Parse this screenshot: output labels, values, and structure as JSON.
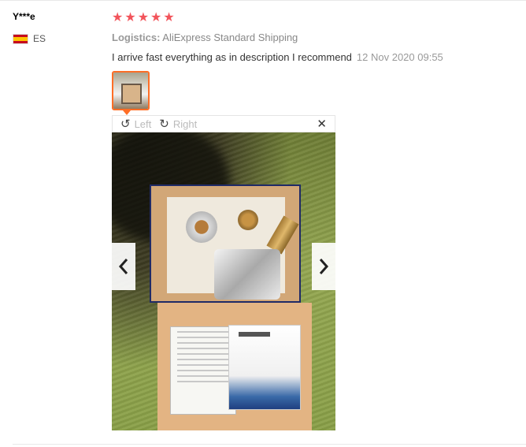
{
  "review": {
    "user_name": "Y***e",
    "country_code": "ES",
    "rating": 5,
    "stars": [
      "★",
      "★",
      "★",
      "★",
      "★"
    ],
    "logistics_label": "Logistics:",
    "logistics_value": " AliExpress Standard Shipping",
    "text": "I arrive fast everything as in description I recommend",
    "date": "12 Nov 2020 09:55"
  },
  "viewer": {
    "rotate_left_label": "Left",
    "rotate_right_label": "Right",
    "rotate_left_icon": "↺",
    "rotate_right_icon": "↻",
    "close_icon": "✕"
  },
  "colors": {
    "star": "#f2545b",
    "thumb_border": "#ff6e26"
  }
}
